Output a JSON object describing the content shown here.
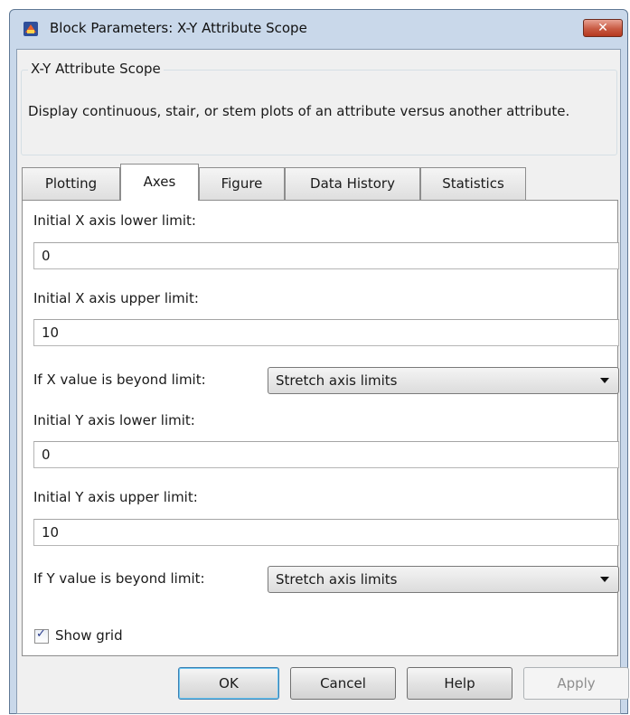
{
  "window": {
    "title": "Block Parameters: X-Y Attribute Scope",
    "close_glyph": "✕"
  },
  "group": {
    "title": "X-Y Attribute Scope",
    "description": "Display continuous, stair, or stem plots of an attribute versus another attribute."
  },
  "tabs": [
    {
      "label": "Plotting",
      "active": false
    },
    {
      "label": "Axes",
      "active": true
    },
    {
      "label": "Figure",
      "active": false
    },
    {
      "label": "Data History",
      "active": false
    },
    {
      "label": "Statistics",
      "active": false
    }
  ],
  "axes": {
    "x_lower": {
      "label": "Initial X axis lower limit:",
      "value": "0"
    },
    "x_upper": {
      "label": "Initial X axis upper limit:",
      "value": "10"
    },
    "x_beyond": {
      "label": "If X value is beyond limit:",
      "value": "Stretch axis limits"
    },
    "y_lower": {
      "label": "Initial Y axis lower limit:",
      "value": "0"
    },
    "y_upper": {
      "label": "Initial Y axis upper limit:",
      "value": "10"
    },
    "y_beyond": {
      "label": "If Y value is beyond limit:",
      "value": "Stretch axis limits"
    },
    "show_grid": {
      "label": "Show grid",
      "checked": true
    }
  },
  "buttons": {
    "ok": "OK",
    "cancel": "Cancel",
    "help": "Help",
    "apply": "Apply"
  },
  "icons": {
    "app": "simulink-block-icon",
    "close": "close-icon",
    "dropdown": "chevron-down-icon",
    "check": "checkmark-icon"
  },
  "colors": {
    "title_bar": "#c9d8ea",
    "close_button": "#c85a43",
    "dialog_background": "#f0f0f0",
    "panel_background": "#ffffff"
  }
}
